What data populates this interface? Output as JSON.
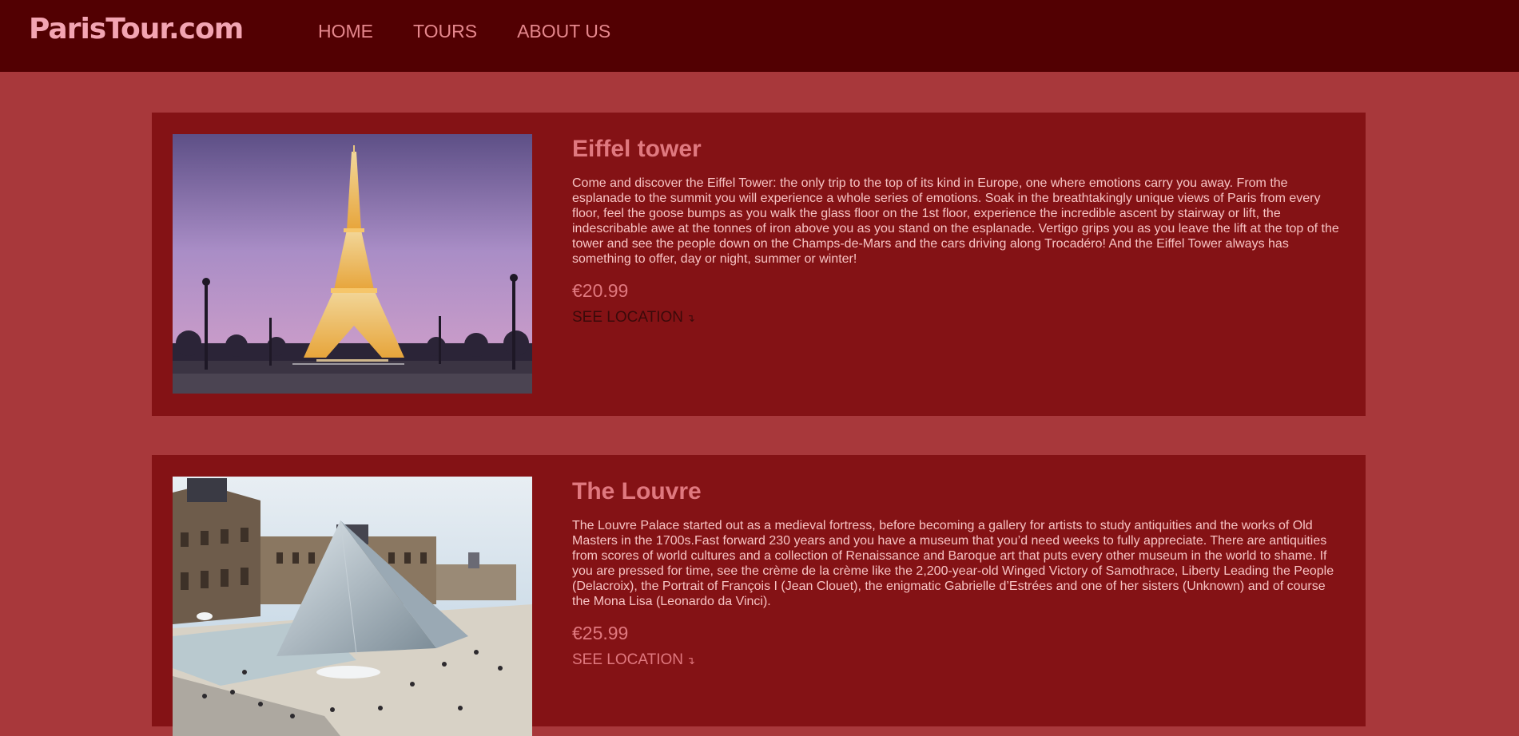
{
  "header": {
    "logo": "ParisTour.com",
    "nav": [
      "HOME",
      "TOURS",
      "ABOUT US"
    ]
  },
  "tours": [
    {
      "title": "Eiffel tower",
      "description": "Come and discover the Eiffel Tower: the only trip to the top of its kind in Europe, one where emotions carry you away. From the esplanade to the summit you will experience a whole series of emotions. Soak in the breathtakingly unique views of Paris from every floor, feel the goose bumps as you walk the glass floor on the 1st floor, experience the incredible ascent by stairway or lift, the indescribable awe at the tonnes of iron above you as you stand on the esplanade. Vertigo grips you as you leave the lift at the top of the tower and see the people down on the Champs-de-Mars and the cars driving along Trocadéro! And the Eiffel Tower always has something to offer, day or night, summer or winter!",
      "price": "€20.99",
      "location_label": "SEE LOCATION",
      "location_icon": "↴"
    },
    {
      "title": "The Louvre",
      "description": "The Louvre Palace started out as a medieval fortress, before becoming a gallery for artists to study antiquities and the works of Old Masters in the 1700s.Fast forward 230 years and you have a museum that you’d need weeks to fully appreciate. There are antiquities from scores of world cultures and a collection of Renaissance and Baroque art that puts every other museum in the world to shame. If you are pressed for time, see the crème de la crème like the 2,200-year-old Winged Victory of Samothrace, Liberty Leading the People (Delacroix), the Portrait of François I (Jean Clouet), the enigmatic Gabrielle d’Estrées and one of her sisters (Unknown) and of course the Mona Lisa (Leonardo da Vinci).",
      "price": "€25.99",
      "location_label": "SEE LOCATION",
      "location_icon": "↴"
    }
  ],
  "colors": {
    "header_bg": "#520002",
    "page_bg": "#a8383b",
    "card_bg": "#841215",
    "accent": "#e0787f"
  }
}
